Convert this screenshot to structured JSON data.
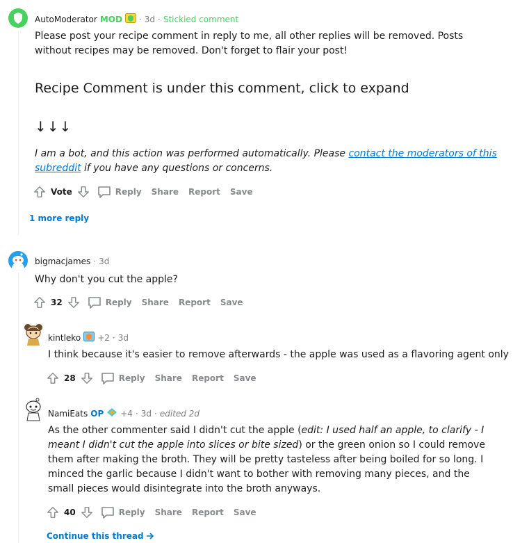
{
  "comments": [
    {
      "user": "AutoModerator",
      "mod_badge": "MOD",
      "time": "3d",
      "stickied": "Stickied comment",
      "paragraph1": "Please post your recipe comment in reply to me, all other replies will be removed. Posts without recipes may be removed. Don't forget to flair your post!",
      "heading": "Recipe Comment is under this comment, click to expand",
      "arrows": "↓↓↓",
      "bot_text_before": "I am a bot, and this action was performed automatically. Please ",
      "bot_link": "contact the moderators of this subreddit",
      "bot_text_after": " if you have any questions or concerns.",
      "vote_label": "Vote",
      "actions": {
        "reply": "Reply",
        "share": "Share",
        "report": "Report",
        "save": "Save"
      },
      "more_replies": "1 more reply"
    },
    {
      "user": "bigmacjames",
      "time": "3d",
      "text": "Why don't you cut the apple?",
      "votes": "32",
      "actions": {
        "reply": "Reply",
        "share": "Share",
        "report": "Report",
        "save": "Save"
      }
    },
    {
      "user": "kintleko",
      "flair_extra": "+2",
      "time": "3d",
      "text": "I think because it's easier to remove afterwards - the apple was used as a flavoring agent only",
      "votes": "28",
      "actions": {
        "reply": "Reply",
        "share": "Share",
        "report": "Report",
        "save": "Save"
      }
    },
    {
      "user": "NamiEats",
      "op_badge": "OP",
      "flair_extra": "+4",
      "time": "3d",
      "edited": "edited 2d",
      "text_a": "As the other commenter said I didn't cut the apple (",
      "text_b": "edit: I used half an apple, to clarify - I meant I didn't cut the apple into slices or bite sized",
      "text_c": ") or the green onion so I could remove them after making the broth. They will be pretty tasteless after being boiled for so long. I minced the garlic because I didn't want to bother with removing many pieces, and the small pieces would disintegrate into the broth anyways.",
      "votes": "40",
      "actions": {
        "reply": "Reply",
        "share": "Share",
        "report": "Report",
        "save": "Save"
      },
      "continue": "Continue this thread"
    }
  ],
  "colors": {
    "mod_green": "#46d160",
    "link_blue": "#0079d3",
    "meta_gray": "#7c7c7c",
    "action_gray": "#878a8c"
  }
}
